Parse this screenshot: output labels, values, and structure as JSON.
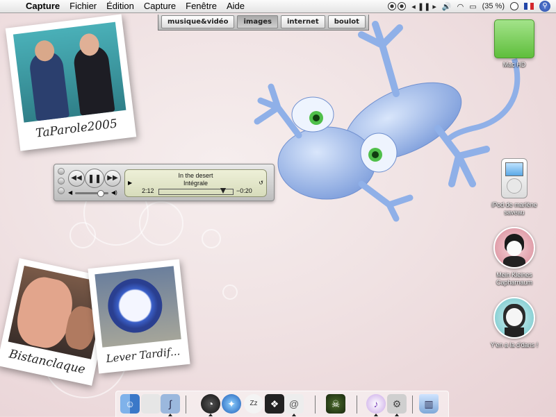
{
  "menubar": {
    "app_name": "Capture",
    "items": [
      "Fichier",
      "Édition",
      "Capture",
      "Fenêtre",
      "Aide"
    ],
    "battery": "(35 %)"
  },
  "tabs": [
    {
      "label": "musique&vidéo",
      "active": false
    },
    {
      "label": "images",
      "active": true
    },
    {
      "label": "internet",
      "active": false
    },
    {
      "label": "boulot",
      "active": false
    }
  ],
  "photos": [
    {
      "caption": "TaParole2005"
    },
    {
      "caption": "Bistanclaque"
    },
    {
      "caption": "Lever Tardif..."
    }
  ],
  "player": {
    "title": "In the desert",
    "album": "Intégrale",
    "elapsed": "2:12",
    "remaining": "−0:20",
    "progress": 0.87,
    "volume": 0.75
  },
  "desktop_icons": [
    {
      "label": "Mac HD",
      "icon": "hard-drive-icon"
    },
    {
      "label": "iPod de marlène saveau",
      "icon": "ipod-icon"
    },
    {
      "label": " Mein Kleines  Capharnaum",
      "icon": "avatar-icon"
    },
    {
      "label": "Y'en a la d'dans !",
      "icon": "avatar-icon"
    }
  ],
  "dock": {
    "items": [
      "finder-icon",
      "apple-icon",
      "script-icon",
      "dashboard-icon",
      "safari-icon",
      "ichat-icon",
      "photo-icon",
      "mail-icon",
      "game-icon",
      "itunes-icon",
      "preferences-icon",
      "trash-icon"
    ]
  },
  "colors": {
    "background": "#f0e2e3",
    "gecko": "#8fb0e8",
    "mac_hd": "#6fcb4a"
  }
}
